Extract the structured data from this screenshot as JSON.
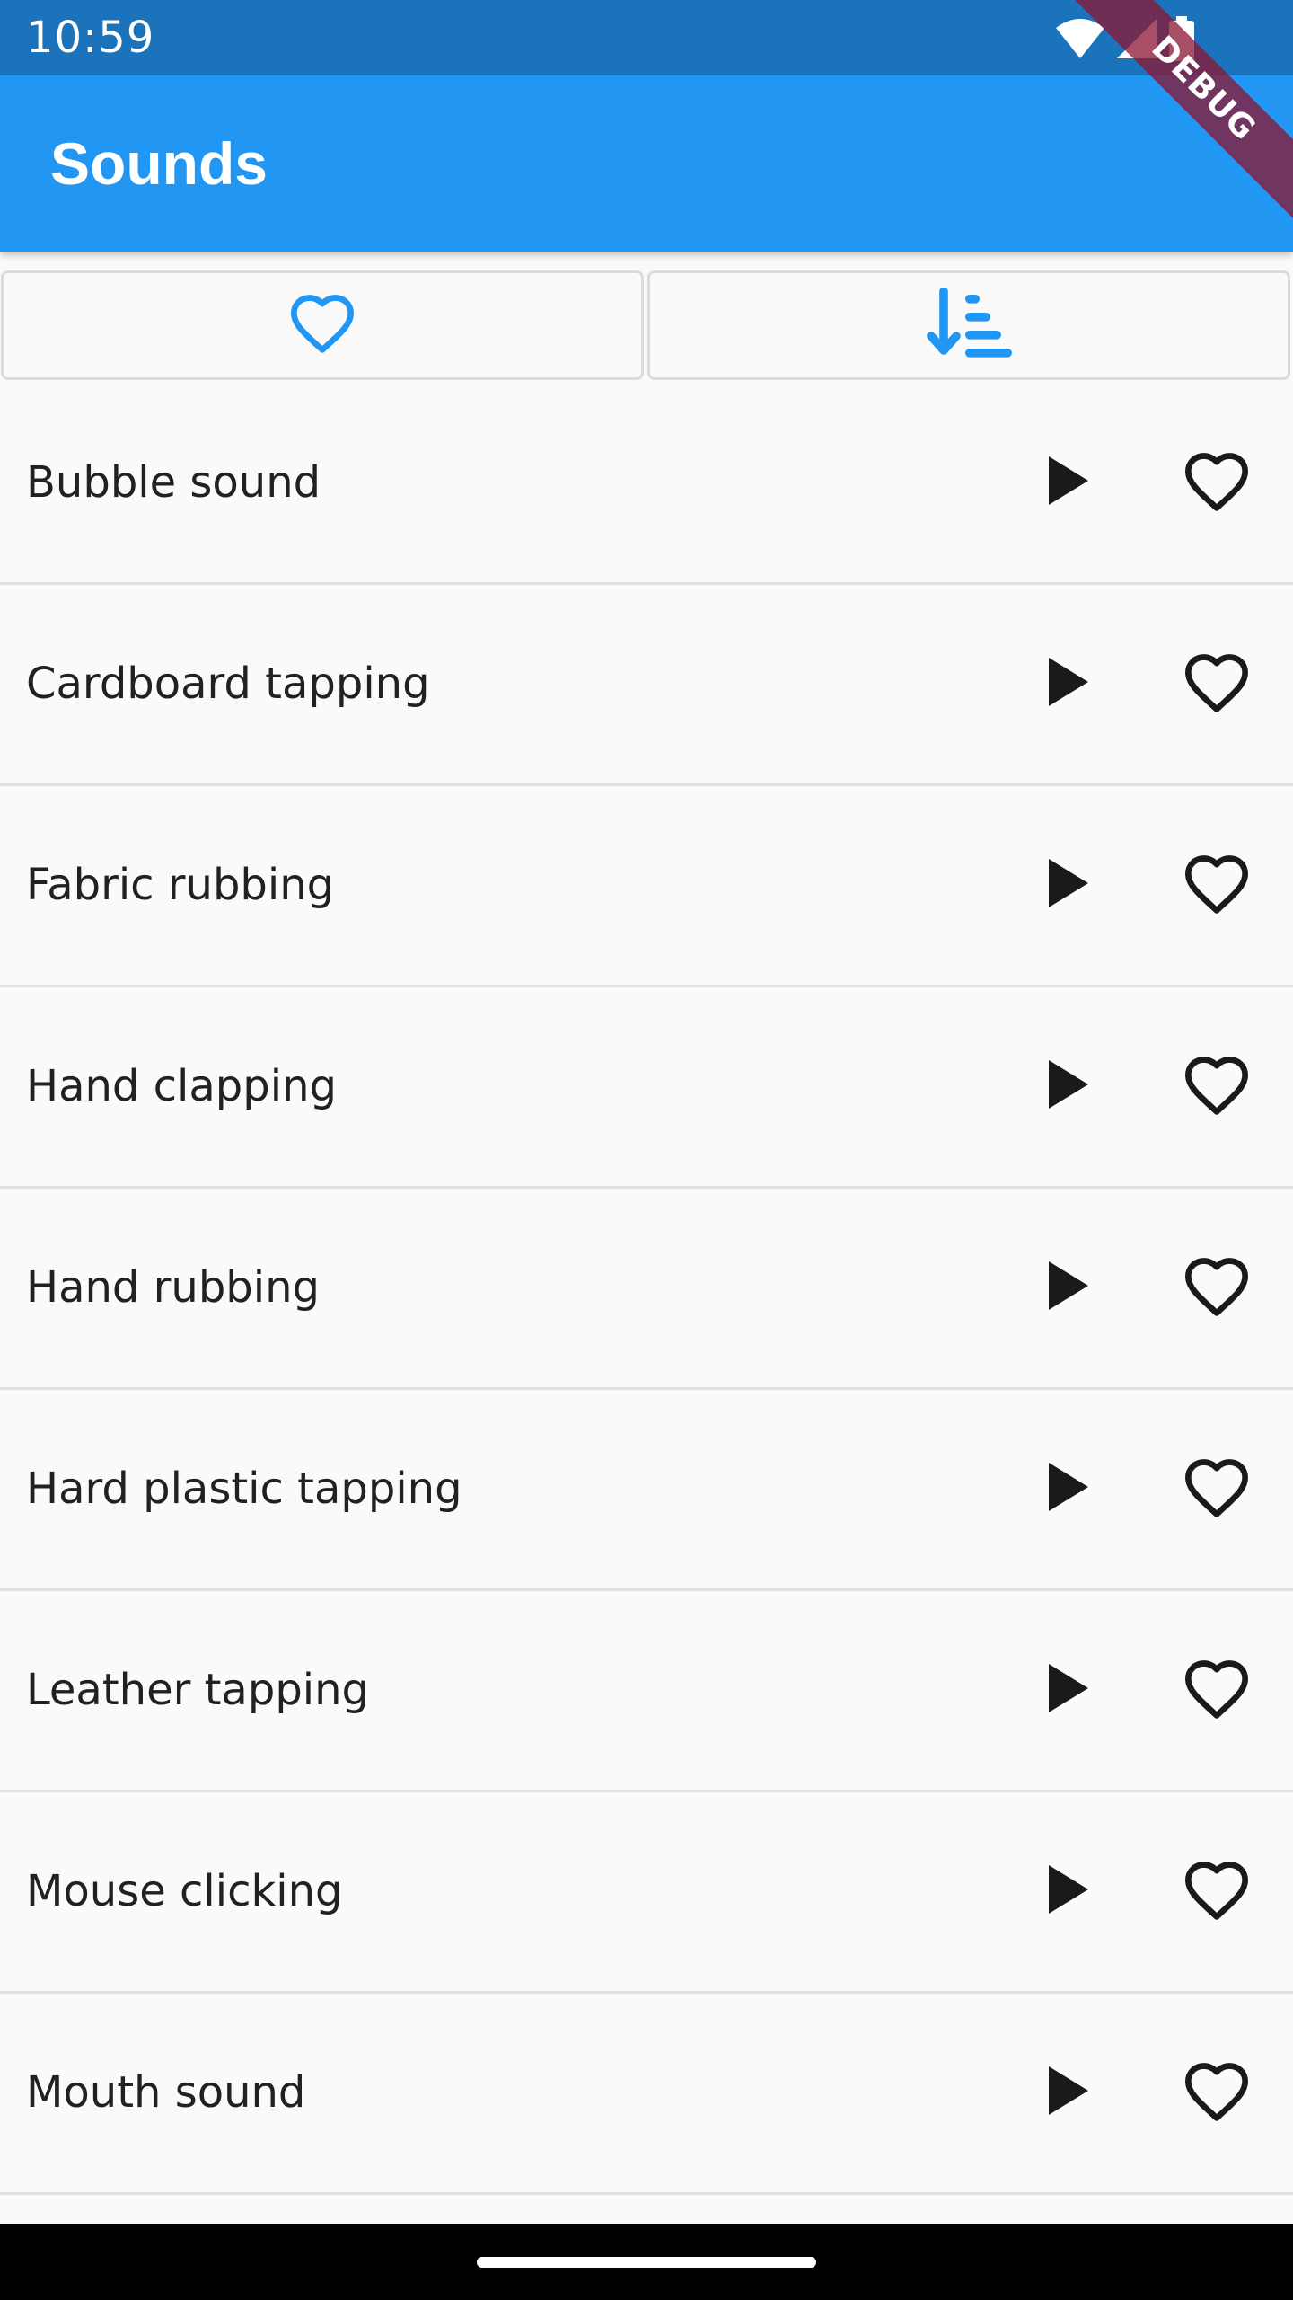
{
  "status_bar": {
    "time": "10:59",
    "icons": [
      "wifi-icon",
      "cellular-signal-icon",
      "battery-icon"
    ],
    "background": "#1b74bb"
  },
  "app_bar": {
    "title": "Sounds",
    "background": "#2196f3"
  },
  "debug_banner": {
    "label": "DEBUG"
  },
  "toggles": {
    "favorites_icon": "heart-outline-icon",
    "sort_icon": "sort-ascending-icon",
    "accent": "#2196f3"
  },
  "sounds": [
    {
      "name": "Bubble sound"
    },
    {
      "name": "Cardboard tapping"
    },
    {
      "name": "Fabric rubbing"
    },
    {
      "name": "Hand clapping"
    },
    {
      "name": "Hand rubbing"
    },
    {
      "name": "Hard plastic tapping"
    },
    {
      "name": "Leather tapping"
    },
    {
      "name": "Mouse clicking"
    },
    {
      "name": "Mouth sound"
    },
    {
      "name": ""
    }
  ],
  "item_icons": {
    "play": "play-icon",
    "favorite": "heart-outline-icon"
  }
}
